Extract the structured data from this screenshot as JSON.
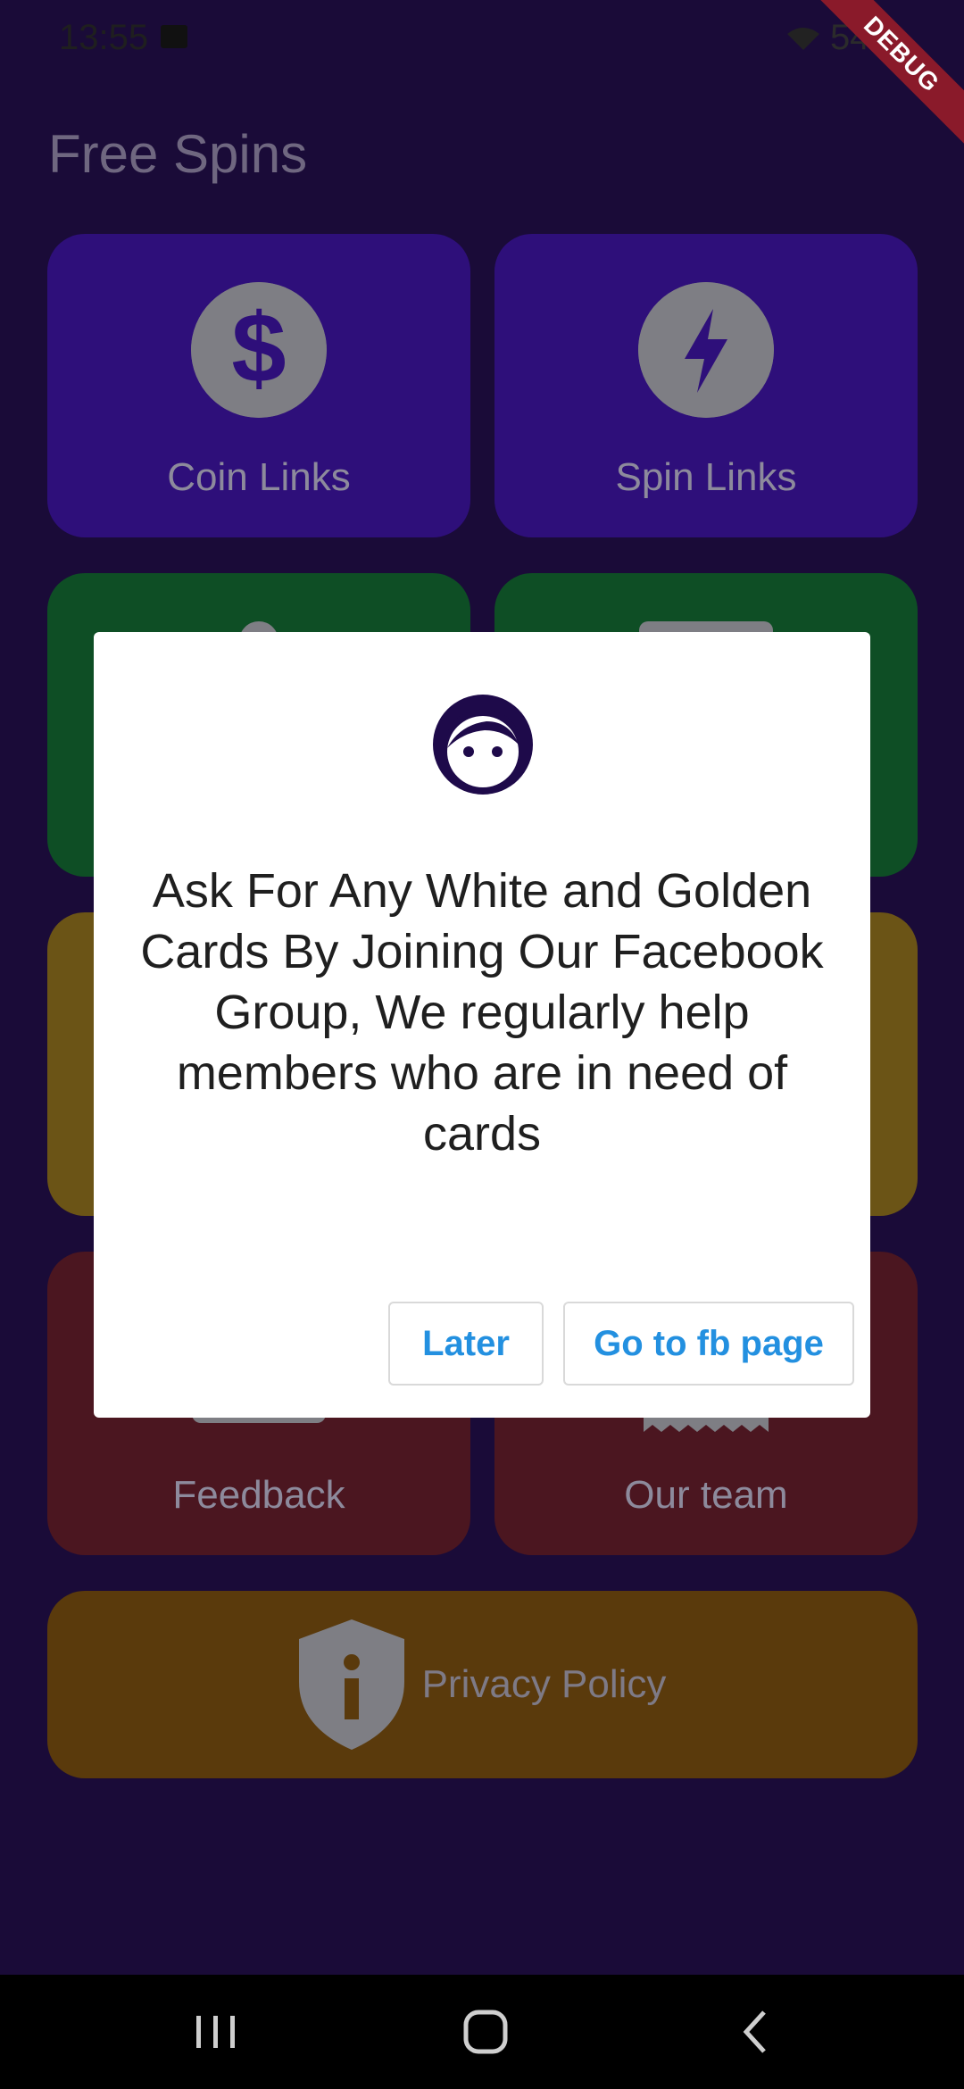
{
  "status_bar": {
    "time": "13:55",
    "battery": "54%"
  },
  "debug_ribbon": "DEBUG",
  "page": {
    "title": "Free Spins"
  },
  "tiles": {
    "coin_links": "Coin Links",
    "spin_links": "Spin Links",
    "feedback": "Feedback",
    "our_team": "Our team",
    "privacy_policy": "Privacy Policy"
  },
  "dialog": {
    "message": "Ask For Any White and Golden Cards By Joining Our Facebook Group, We regularly help members who are in need of cards",
    "later_label": "Later",
    "fb_label": "Go to fb page"
  },
  "colors": {
    "background": "#1a0b38",
    "purple_tile": "#2e0f7a",
    "green_tile": "#0e4e25",
    "yellow_tile": "#6b5416",
    "red_tile": "#4b1620",
    "orange_tile": "#5a3a0c",
    "accent": "#2390e0"
  },
  "icons": {
    "coin": "dollar-icon",
    "spin": "lightning-icon",
    "privacy": "shield-info-icon",
    "dialog": "face-icon"
  }
}
